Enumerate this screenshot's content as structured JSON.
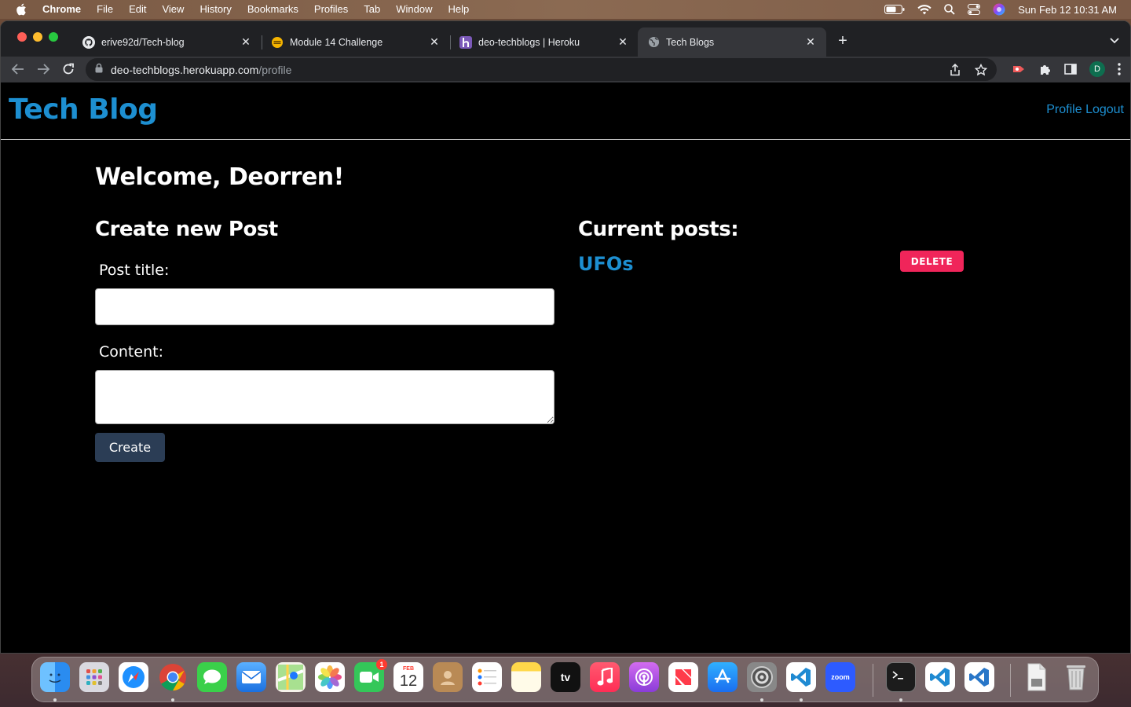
{
  "menubar": {
    "app": "Chrome",
    "items": [
      "File",
      "Edit",
      "View",
      "History",
      "Bookmarks",
      "Profiles",
      "Tab",
      "Window",
      "Help"
    ],
    "clock": "Sun Feb 12  10:31 AM"
  },
  "browser": {
    "tabs": [
      {
        "title": "erive92d/Tech-blog",
        "icon": "github-icon"
      },
      {
        "title": "Module 14 Challenge",
        "icon": "module-icon"
      },
      {
        "title": "deo-techblogs | Heroku",
        "icon": "heroku-icon"
      },
      {
        "title": "Tech Blogs",
        "icon": "globe-icon"
      }
    ],
    "url_host": "deo-techblogs.herokuapp.com",
    "url_path": "/profile",
    "profile_initial": "D"
  },
  "site": {
    "brand": "Tech Blog",
    "nav": {
      "profile": "Profile",
      "logout": "Logout"
    }
  },
  "profile": {
    "welcome": "Welcome, Deorren!",
    "create_heading": "Create new Post",
    "title_label": "Post title:",
    "content_label": "Content:",
    "create_button": "Create",
    "current_heading": "Current posts:",
    "posts": [
      {
        "title": "UFOs",
        "delete_label": "DELETE"
      }
    ]
  },
  "dock": {
    "facetime_badge": "1",
    "calendar_month": "FEB",
    "calendar_day": "12",
    "zoom_label": "zoom",
    "tv_label": "tv"
  },
  "colors": {
    "link_blue": "#1d8fd1",
    "create_button": "#2b3d55",
    "delete_button": "#f0255a"
  }
}
